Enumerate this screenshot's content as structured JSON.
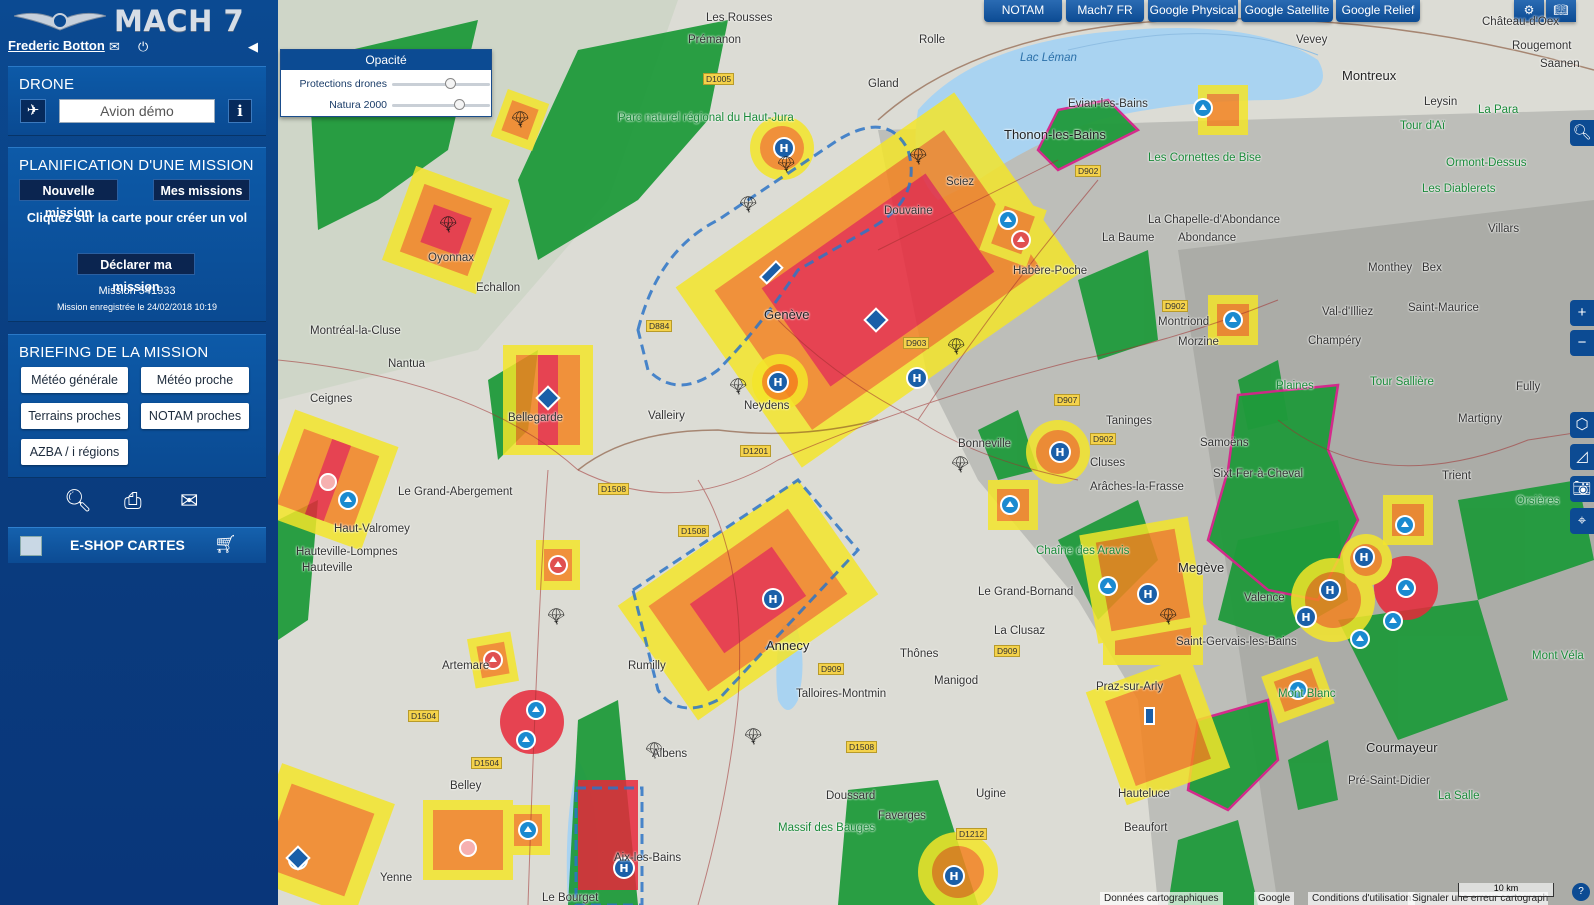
{
  "app": {
    "title": "MACH 7"
  },
  "user": {
    "name": "Frederic Botton"
  },
  "drone": {
    "heading": "DRONE",
    "value": "Avion démo"
  },
  "planning": {
    "heading": "PLANIFICATION D'UNE MISSION",
    "new_mission": "Nouvelle mission",
    "my_missions": "Mes missions",
    "hint": "Cliquez sur la carte pour créer un vol",
    "declare": "Déclarer ma mission",
    "mission_number": "Mission 541933",
    "mission_saved": "Mission enregistrée le 24/02/2018 10:19"
  },
  "briefing": {
    "heading": "BRIEFING DE LA MISSION",
    "buttons": [
      "Météo générale",
      "Météo proche",
      "Terrains proches",
      "NOTAM proches",
      "AZBA / i régions"
    ]
  },
  "eshop": {
    "label": "E-SHOP CARTES"
  },
  "map_tabs": [
    "NOTAM",
    "Mach7 FR",
    "Google Physical",
    "Google Satellite",
    "Google Relief"
  ],
  "opacity": {
    "title": "Opacité",
    "sliders": [
      {
        "label": "Protections drones",
        "value": 0.6
      },
      {
        "label": "Natura 2000",
        "value": 0.7
      }
    ]
  },
  "places": [
    "Les Rousses",
    "Prémanon",
    "Rolle",
    "Vevey",
    "Montreux",
    "Lac Léman",
    "Gland",
    "Thonon-les-Bains",
    "Evian-les-Bains",
    "Oyonnax",
    "Bellegarde",
    "Genève",
    "Montréal-la-Cluse",
    "Nantua",
    "Ceignes",
    "Echallon",
    "Bonneville",
    "Cluses",
    "Le Grand-Abergement",
    "Haut-Valromey",
    "Hauteville-Lompnes",
    "Annecy",
    "Rumilly",
    "Talloires-Montmin",
    "Thônes",
    "La Clusaz",
    "Le Grand-Bornand",
    "Saint-Gervais-les-Bains",
    "Praz-sur-Arly",
    "Megève",
    "Courmayeur",
    "Pré-Saint-Didier",
    "La Salle",
    "Martigny",
    "Bex",
    "Monthey",
    "Champéry",
    "Les Diablerets",
    "Ormont-Dessus",
    "La Chapelle-d'Abondance",
    "Abondance",
    "Morzine",
    "Samoëns",
    "Taninges",
    "Sixt-Fer-à-Cheval",
    "Arâches-la-Frasse",
    "Habère-Poche",
    "Sciez",
    "Douvaine",
    "Valleiry",
    "Neydens",
    "Belley",
    "Artemare",
    "Albens",
    "Aix-les-Bains",
    "Le Bourget",
    "Yenne",
    "Ugine",
    "Beaufort",
    "Hauteluce",
    "Doussard",
    "Faverges",
    "Manigod",
    "Mont Blanc",
    "Valence",
    "Orsières",
    "Trient",
    "Fully",
    "La Baume",
    "Les Cornettes de Bise",
    "Tour d'Aï",
    "La Para",
    "Leysin",
    "Château-d'Oex",
    "Plaines",
    "Tour Sallière",
    "Massif des Bauges",
    "Parc naturel régional du Haut-Jura",
    "Chaîne des Aravis",
    "Hauteville",
    "Mont Véla",
    "Montriond",
    "Saint-Maurice",
    "Val-d'Illiez",
    "Villars",
    "Rougemont",
    "Saanen"
  ],
  "attribution": {
    "map_data": "Données cartographiques",
    "google": "Google",
    "terms": "Conditions d'utilisation",
    "report": "Signaler une erreur cartographique",
    "scale": "10 km",
    "zoom": "zoom"
  },
  "colors": {
    "accent": "#0c4b93",
    "zone_red": "#e8283a",
    "zone_orange": "#f4831f",
    "zone_yellow": "#f4e62a",
    "natura": "#1a9a3a",
    "natura_border": "#d6248a"
  }
}
